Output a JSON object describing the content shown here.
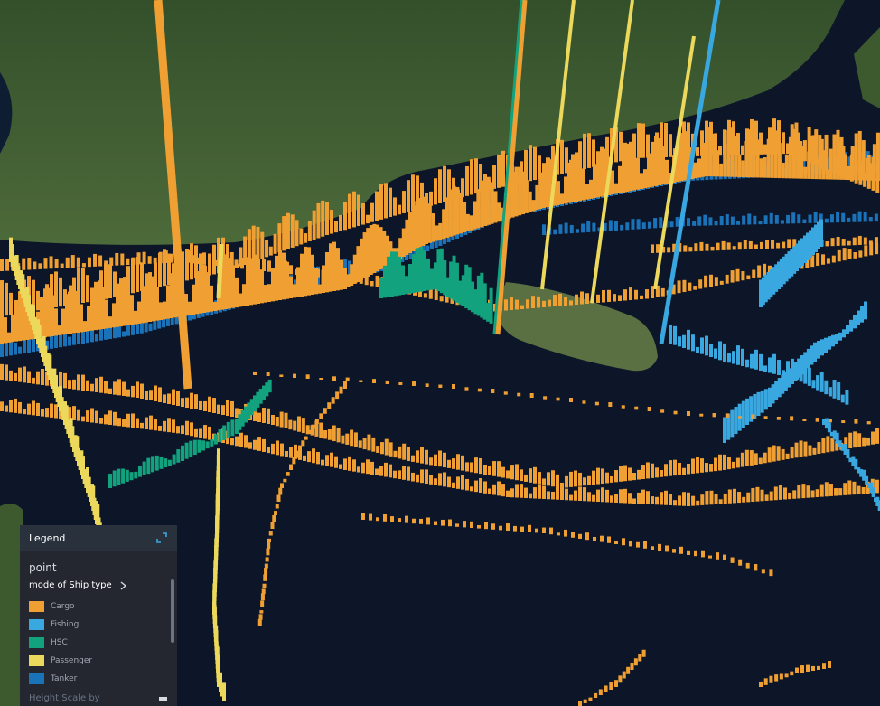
{
  "legend": {
    "title": "Legend",
    "layer_name": "point",
    "field_label": "mode of Ship type",
    "items": [
      {
        "label": "Cargo",
        "color": "#f0a032"
      },
      {
        "label": "Fishing",
        "color": "#3aa8e0"
      },
      {
        "label": "HSC",
        "color": "#12a37e"
      },
      {
        "label": "Passenger",
        "color": "#ecd95c"
      },
      {
        "label": "Tanker",
        "color": "#1a72b8"
      }
    ],
    "height_scale_label": "Height Scale by"
  },
  "map": {
    "ocean_color": "#0c1528",
    "land_color": "#3d5a2f"
  }
}
